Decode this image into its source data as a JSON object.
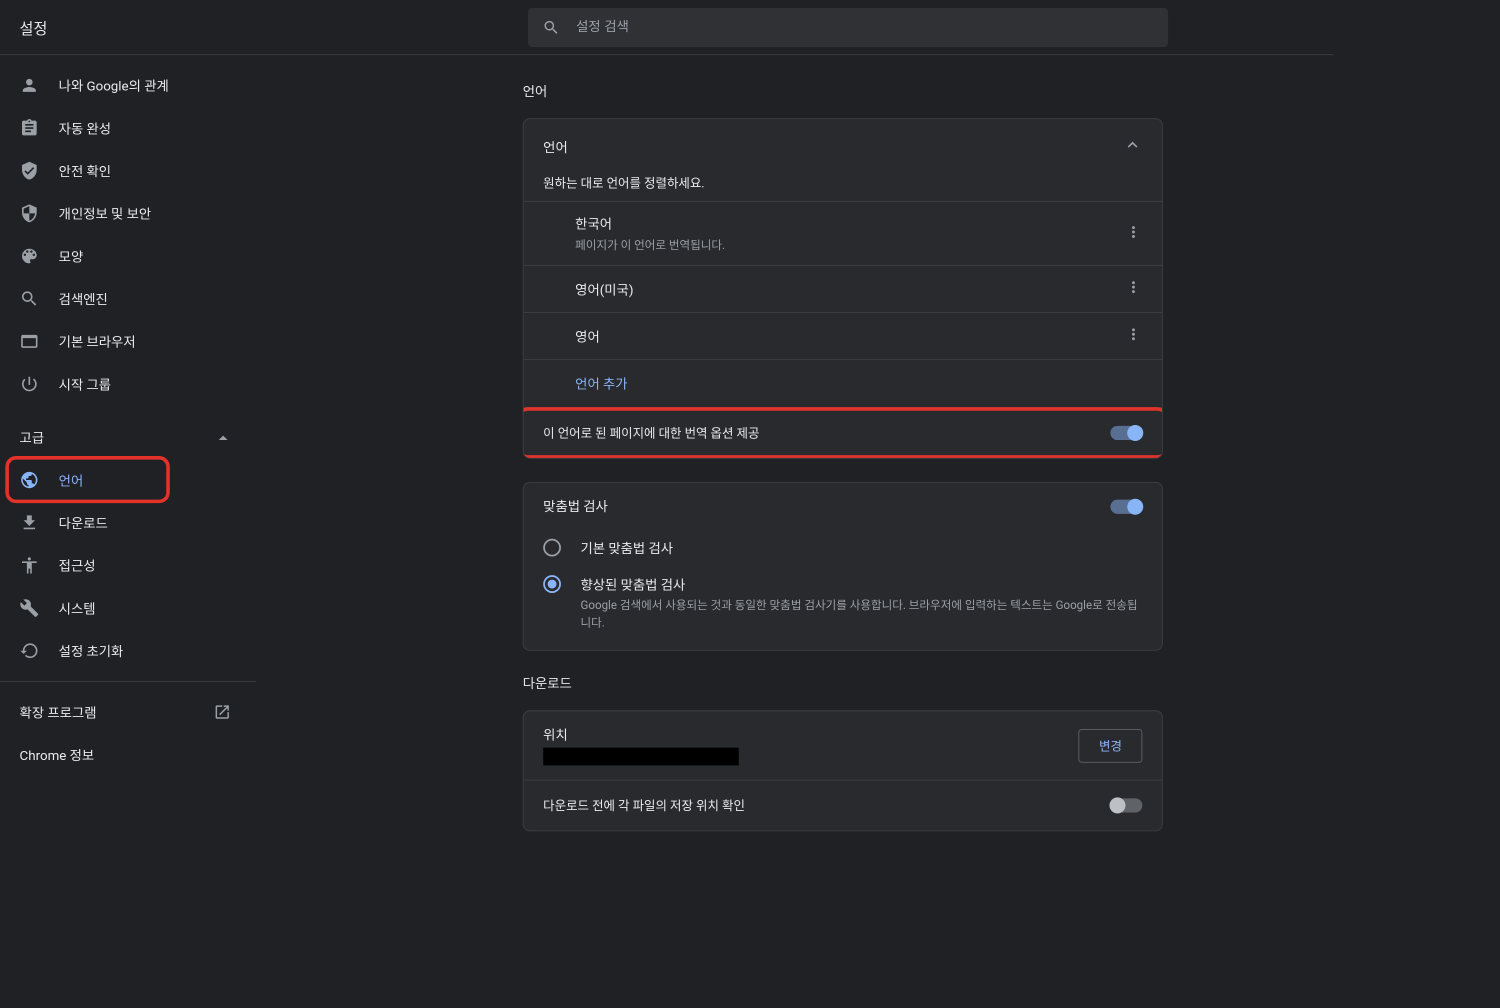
{
  "header": {
    "title": "설정",
    "search_placeholder": "설정 검색"
  },
  "sidebar": {
    "items": [
      {
        "label": "나와 Google의 관계",
        "icon": "person"
      },
      {
        "label": "자동 완성",
        "icon": "autofill"
      },
      {
        "label": "안전 확인",
        "icon": "shield-check"
      },
      {
        "label": "개인정보 및 보안",
        "icon": "shield"
      },
      {
        "label": "모양",
        "icon": "palette"
      },
      {
        "label": "검색엔진",
        "icon": "search"
      },
      {
        "label": "기본 브라우저",
        "icon": "browser"
      },
      {
        "label": "시작 그룹",
        "icon": "power"
      }
    ],
    "advanced_label": "고급",
    "advanced_items": [
      {
        "label": "언어",
        "icon": "globe",
        "active": true
      },
      {
        "label": "다운로드",
        "icon": "download"
      },
      {
        "label": "접근성",
        "icon": "accessibility"
      },
      {
        "label": "시스템",
        "icon": "wrench"
      },
      {
        "label": "설정 초기화",
        "icon": "restore"
      }
    ],
    "extensions_label": "확장 프로그램",
    "about_label": "Chrome 정보"
  },
  "main": {
    "lang_section_title": "언어",
    "lang_card": {
      "header": "언어",
      "desc": "원하는 대로 언어를 정렬하세요.",
      "languages": [
        {
          "name": "한국어",
          "sub": "페이지가 이 언어로 번역됩니다."
        },
        {
          "name": "영어(미국)",
          "sub": ""
        },
        {
          "name": "영어",
          "sub": ""
        }
      ],
      "add_label": "언어 추가",
      "translate_option": "이 언어로 된 페이지에 대한 번역 옵션 제공"
    },
    "spell_card": {
      "header": "맞춤법 검사",
      "basic": "기본 맞춤법 검사",
      "enhanced": "향상된 맞춤법 검사",
      "enhanced_sub": "Google 검색에서 사용되는 것과 동일한 맞춤법 검사기를 사용합니다. 브라우저에 입력하는 텍스트는 Google로 전송됩니다."
    },
    "download_section_title": "다운로드",
    "download_card": {
      "location_label": "위치",
      "change_label": "변경",
      "ask_label": "다운로드 전에 각 파일의 저장 위치 확인"
    }
  }
}
